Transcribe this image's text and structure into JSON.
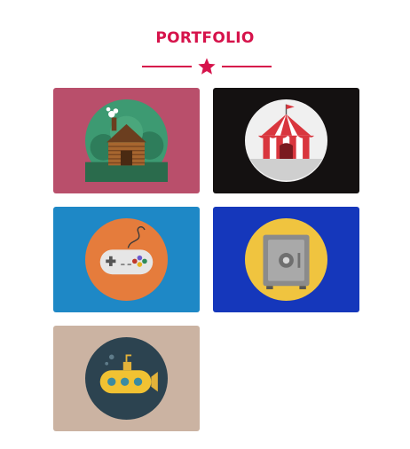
{
  "header": {
    "title": "PORTFOLIO",
    "accent_color": "#d6134b",
    "divider_icon": "star-icon"
  },
  "portfolio": {
    "items": [
      {
        "icon": "log-cabin-icon",
        "bg_color": "#b94f6b",
        "circle_color": "#3d9a72"
      },
      {
        "icon": "circus-tent-icon",
        "bg_color": "#141111",
        "circle_color": "#f0f0f0"
      },
      {
        "icon": "game-controller-icon",
        "bg_color": "#1e88c6",
        "circle_color": "#e57c3c"
      },
      {
        "icon": "safe-vault-icon",
        "bg_color": "#1537bb",
        "circle_color": "#f0c43f"
      },
      {
        "icon": "submarine-icon",
        "bg_color": "#cbb3a2",
        "circle_color": "#2c4350"
      }
    ]
  }
}
